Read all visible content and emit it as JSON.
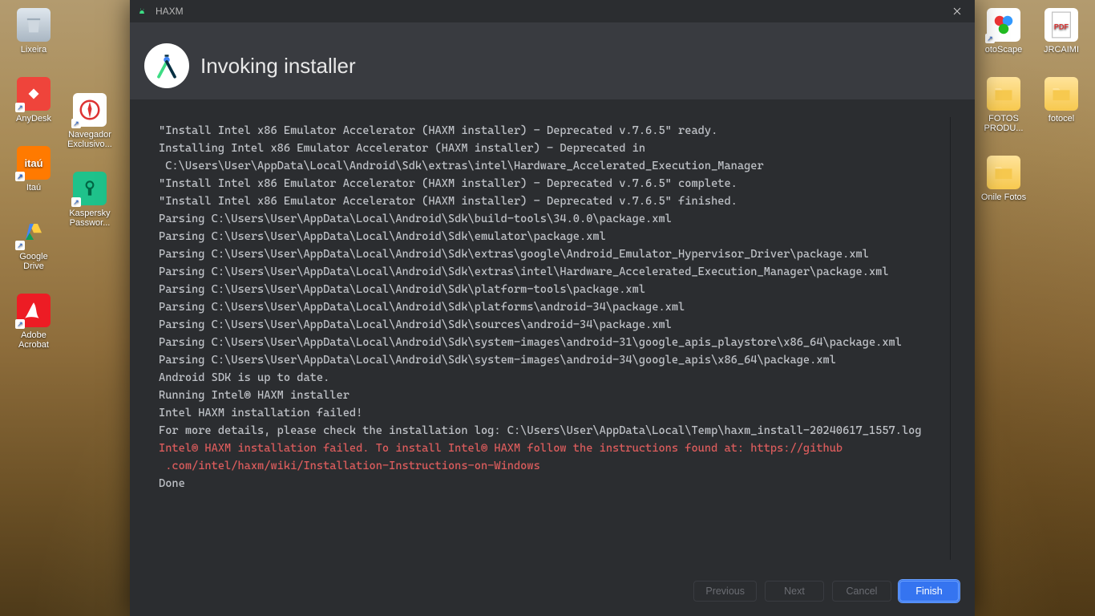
{
  "desktop_icons": {
    "left1": [
      {
        "label": "Lixeira",
        "kind": "bin"
      },
      {
        "label": "AnyDesk",
        "kind": "anydesk",
        "shortcut": true
      },
      {
        "label": "Itaú",
        "kind": "itau",
        "shortcut": true,
        "glyph": "itaú"
      },
      {
        "label": "Google Drive",
        "kind": "gdrive",
        "shortcut": true
      },
      {
        "label": "Adobe Acrobat",
        "kind": "acrobat",
        "shortcut": true
      }
    ],
    "left2": [
      {
        "label": "Navegador Exclusivo...",
        "kind": "safari",
        "shortcut": true
      },
      {
        "label": "Kaspersky Passwor...",
        "kind": "kasp",
        "shortcut": true
      }
    ],
    "right1": [
      {
        "label": "otoScape",
        "kind": "pscape",
        "shortcut": true
      },
      {
        "label": "FOTOS PRODU...",
        "kind": "folder"
      },
      {
        "label": "Onile Fotos",
        "kind": "folder"
      }
    ],
    "right2": [
      {
        "label": "JRCAIMI",
        "kind": "pdf"
      },
      {
        "label": "fotocel",
        "kind": "folder"
      }
    ]
  },
  "dialog": {
    "window_title": "HAXM",
    "heading": "Invoking installer",
    "log_lines": [
      {
        "t": "\"Install Intel x86 Emulator Accelerator (HAXM installer) - Deprecated v.7.6.5\" ready."
      },
      {
        "t": "Installing Intel x86 Emulator Accelerator (HAXM installer) - Deprecated in "
      },
      {
        "t": " C:\\Users\\User\\AppData\\Local\\Android\\Sdk\\extras\\intel\\Hardware_Accelerated_Execution_Manager"
      },
      {
        "t": "\"Install Intel x86 Emulator Accelerator (HAXM installer) - Deprecated v.7.6.5\" complete."
      },
      {
        "t": "\"Install Intel x86 Emulator Accelerator (HAXM installer) - Deprecated v.7.6.5\" finished."
      },
      {
        "t": "Parsing C:\\Users\\User\\AppData\\Local\\Android\\Sdk\\build-tools\\34.0.0\\package.xml"
      },
      {
        "t": "Parsing C:\\Users\\User\\AppData\\Local\\Android\\Sdk\\emulator\\package.xml"
      },
      {
        "t": "Parsing C:\\Users\\User\\AppData\\Local\\Android\\Sdk\\extras\\google\\Android_Emulator_Hypervisor_Driver\\package.xml"
      },
      {
        "t": "Parsing C:\\Users\\User\\AppData\\Local\\Android\\Sdk\\extras\\intel\\Hardware_Accelerated_Execution_Manager\\package.xml"
      },
      {
        "t": "Parsing C:\\Users\\User\\AppData\\Local\\Android\\Sdk\\platform-tools\\package.xml"
      },
      {
        "t": "Parsing C:\\Users\\User\\AppData\\Local\\Android\\Sdk\\platforms\\android-34\\package.xml"
      },
      {
        "t": "Parsing C:\\Users\\User\\AppData\\Local\\Android\\Sdk\\sources\\android-34\\package.xml"
      },
      {
        "t": "Parsing C:\\Users\\User\\AppData\\Local\\Android\\Sdk\\system-images\\android-31\\google_apis_playstore\\x86_64\\package.xml"
      },
      {
        "t": "Parsing C:\\Users\\User\\AppData\\Local\\Android\\Sdk\\system-images\\android-34\\google_apis\\x86_64\\package.xml"
      },
      {
        "t": "Android SDK is up to date."
      },
      {
        "t": "Running Intel® HAXM installer"
      },
      {
        "t": "Intel HAXM installation failed!"
      },
      {
        "t": "For more details, please check the installation log: C:\\Users\\User\\AppData\\Local\\Temp\\haxm_install-20240617_1557.log"
      },
      {
        "t": "Intel® HAXM installation failed. To install Intel® HAXM follow the instructions found at: https://github",
        "err": true
      },
      {
        "t": " .com/intel/haxm/wiki/Installation-Instructions-on-Windows",
        "err": true
      },
      {
        "t": "Done"
      }
    ],
    "buttons": {
      "previous": "Previous",
      "next": "Next",
      "cancel": "Cancel",
      "finish": "Finish"
    }
  },
  "colors": {
    "accent": "#3574f0",
    "error": "#db5c5c"
  }
}
